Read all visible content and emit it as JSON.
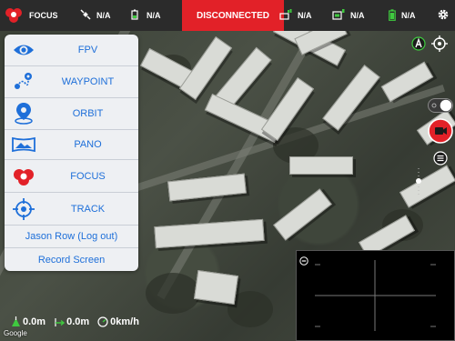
{
  "topbar": {
    "mode_label": "FOCUS",
    "items": [
      {
        "icon": "satellite-icon",
        "value": "N/A"
      },
      {
        "icon": "aircraft-battery-icon",
        "value": "N/A"
      },
      {
        "icon": "remote-signal-icon",
        "value": "N/A"
      },
      {
        "icon": "video-signal-icon",
        "value": "N/A"
      },
      {
        "icon": "battery-icon",
        "value": "N/A"
      }
    ],
    "status": "DISCONNECTED"
  },
  "menu": {
    "items": [
      {
        "icon": "eye-icon",
        "label": "FPV"
      },
      {
        "icon": "waypoint-icon",
        "label": "WAYPOINT"
      },
      {
        "icon": "orbit-icon",
        "label": "ORBIT"
      },
      {
        "icon": "panorama-icon",
        "label": "PANO"
      },
      {
        "icon": "focus-icon",
        "label": "FOCUS"
      },
      {
        "icon": "track-icon",
        "label": "TRACK"
      }
    ],
    "account": "Jason Row (Log out)",
    "record": "Record Screen"
  },
  "telemetry": {
    "altitude": "0.0m",
    "distance": "0.0m",
    "speed": "0km/h"
  },
  "map_attribution": "Google",
  "colors": {
    "accent_blue": "#1e6fd9",
    "alert_red": "#e22128",
    "topbar_bg": "#2b2b2b",
    "battery_green": "#3fc93f"
  }
}
